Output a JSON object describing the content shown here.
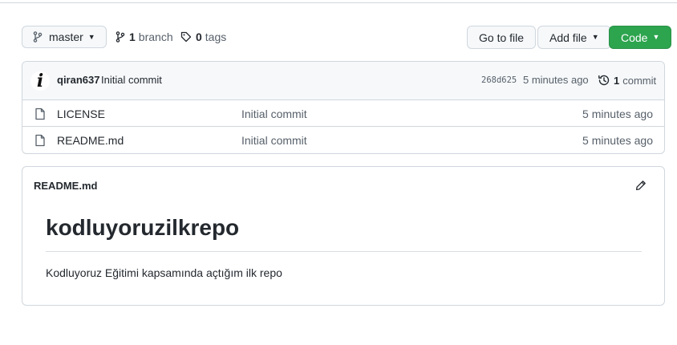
{
  "repo_bar": {
    "branch_name": "master",
    "branch_count": "1",
    "branch_label": "branch",
    "tag_count": "0",
    "tag_label": "tags",
    "goto_file_label": "Go to file",
    "add_file_label": "Add file",
    "code_label": "Code"
  },
  "latest_commit": {
    "avatar_letter": "i",
    "author": "qiran637",
    "message": "Initial commit",
    "sha": "268d625",
    "time": "5 minutes ago",
    "count": "1",
    "count_label": "commit"
  },
  "files": [
    {
      "name": "LICENSE",
      "commit_message": "Initial commit",
      "time": "5 minutes ago"
    },
    {
      "name": "README.md",
      "commit_message": "Initial commit",
      "time": "5 minutes ago"
    }
  ],
  "readme": {
    "filename": "README.md",
    "title": "kodluyoruzilkrepo",
    "body": "Kodluyoruz Eğitimi kapsamında açtığım ilk repo"
  },
  "colors": {
    "code_button": "#2da44e",
    "border": "#d0d7de",
    "muted_text": "#57606a"
  }
}
